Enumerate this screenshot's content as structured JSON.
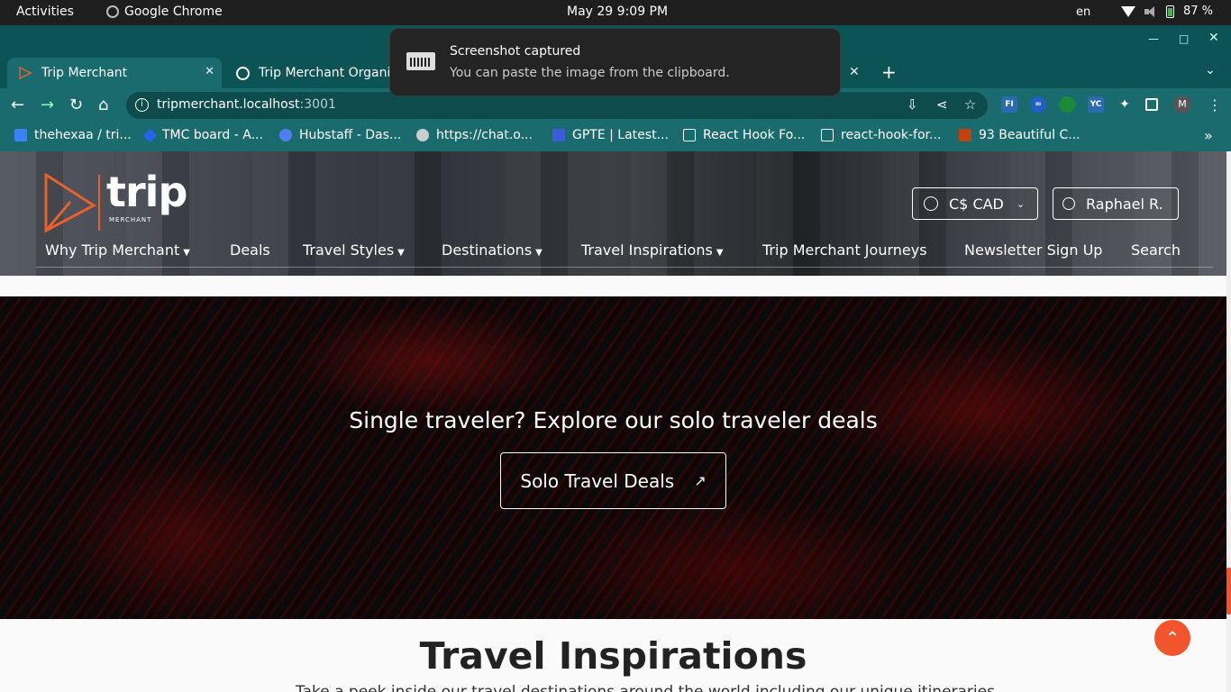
{
  "system": {
    "activities": "Activities",
    "app_name": "Google Chrome",
    "clock": "May 29  9:09 PM",
    "lang": "en",
    "battery": "87 %"
  },
  "tabs": [
    {
      "title": "Trip Merchant"
    },
    {
      "title": "Trip Merchant Organiz"
    }
  ],
  "omnibox": {
    "host": "tripmerchant.localhost",
    "port": ":3001"
  },
  "bookmarks": [
    {
      "label": "thehexaa / tri..."
    },
    {
      "label": "TMC board - A..."
    },
    {
      "label": "Hubstaff - Das..."
    },
    {
      "label": "https://chat.o..."
    },
    {
      "label": "GPTE | Latest..."
    },
    {
      "label": "React Hook Fo..."
    },
    {
      "label": "react-hook-for..."
    },
    {
      "label": "93 Beautiful C..."
    }
  ],
  "extensions": [
    "FI",
    "YC",
    "M"
  ],
  "notification": {
    "title": "Screenshot captured",
    "body": "You can paste the image from the clipboard."
  },
  "site": {
    "logo": {
      "word": "trip",
      "sub": "MERCHANT"
    },
    "currency": "C$ CAD",
    "user": "Raphael R.",
    "nav": [
      {
        "label": "Why Trip Merchant"
      },
      {
        "label": "Deals"
      },
      {
        "label": "Travel Styles"
      },
      {
        "label": "Destinations"
      },
      {
        "label": "Travel Inspirations"
      },
      {
        "label": "Trip Merchant Journeys"
      },
      {
        "label": "Newsletter Sign Up"
      },
      {
        "label": "Search"
      }
    ],
    "solo": {
      "title": "Single traveler? Explore our solo traveler deals",
      "button": "Solo Travel Deals"
    },
    "inspirations": {
      "title": "Travel Inspirations",
      "subtitle": "Take a peek inside our travel destinations around the world including our unique itineraries"
    }
  },
  "colors": {
    "chrome_frame": "#0b5355",
    "accent": "#f2542d"
  }
}
